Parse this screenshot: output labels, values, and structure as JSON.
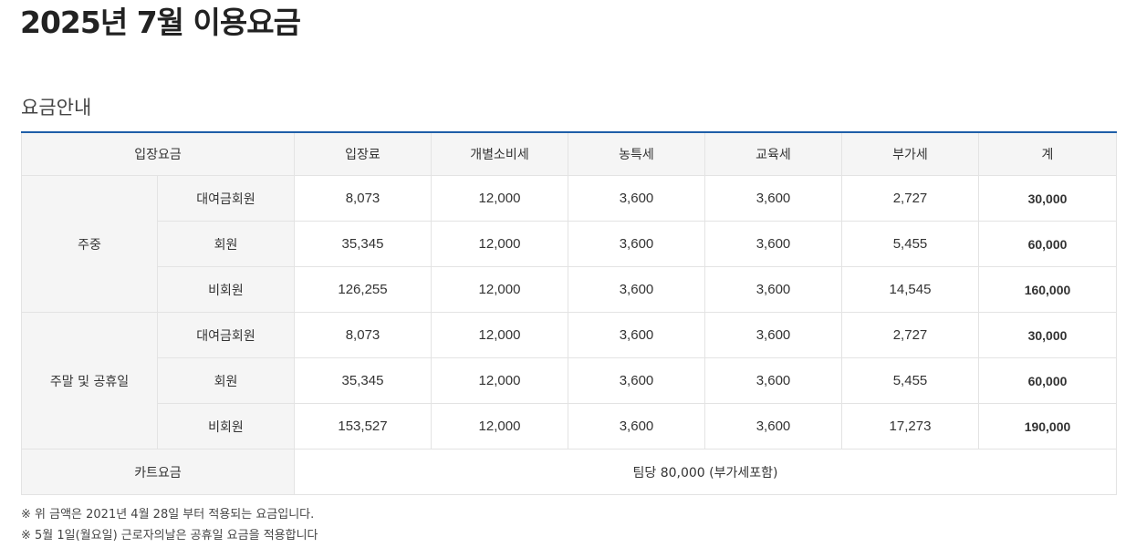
{
  "page_title": "2025년 7월 이용요금",
  "section_title": "요금안내",
  "table": {
    "headers": [
      "입장요금",
      "입장료",
      "개별소비세",
      "농특세",
      "교육세",
      "부가세",
      "계"
    ],
    "groups": [
      {
        "label": "주중",
        "rows": [
          {
            "type": "대여금회원",
            "values": [
              "8,073",
              "12,000",
              "3,600",
              "3,600",
              "2,727",
              "30,000"
            ]
          },
          {
            "type": "회원",
            "values": [
              "35,345",
              "12,000",
              "3,600",
              "3,600",
              "5,455",
              "60,000"
            ]
          },
          {
            "type": "비회원",
            "values": [
              "126,255",
              "12,000",
              "3,600",
              "3,600",
              "14,545",
              "160,000"
            ]
          }
        ]
      },
      {
        "label": "주말 및 공휴일",
        "rows": [
          {
            "type": "대여금회원",
            "values": [
              "8,073",
              "12,000",
              "3,600",
              "3,600",
              "2,727",
              "30,000"
            ]
          },
          {
            "type": "회원",
            "values": [
              "35,345",
              "12,000",
              "3,600",
              "3,600",
              "5,455",
              "60,000"
            ]
          },
          {
            "type": "비회원",
            "values": [
              "153,527",
              "12,000",
              "3,600",
              "3,600",
              "17,273",
              "190,000"
            ]
          }
        ]
      }
    ],
    "cart": {
      "label": "카트요금",
      "value": "팀당 80,000 (부가세포함)"
    }
  },
  "notes": [
    "※ 위 금액은 2021년 4월 28일 부터 적용되는 요금입니다.",
    "※ 5월 1일(월요일) 근로자의날은 공휴일 요금을 적용합니다"
  ]
}
